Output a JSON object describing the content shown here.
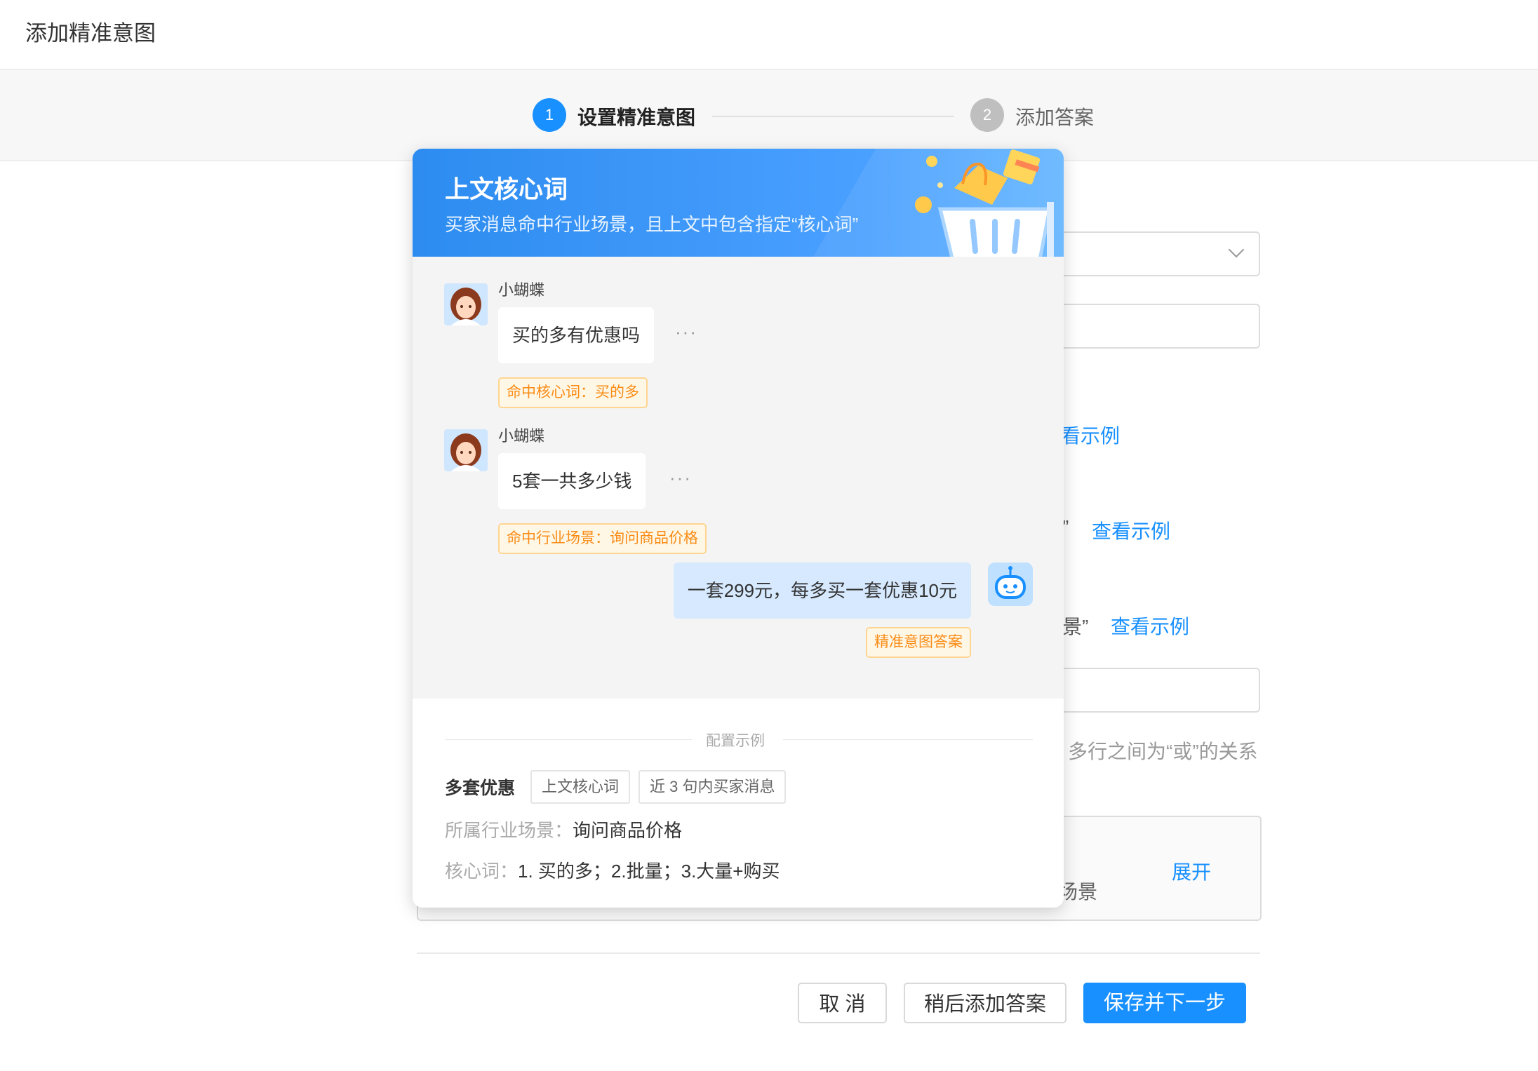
{
  "page": {
    "title": "添加精准意图"
  },
  "steps": [
    {
      "number": "1",
      "label": "设置精准意图",
      "state": "active"
    },
    {
      "number": "2",
      "label": "添加答案",
      "state": "pending"
    }
  ],
  "background": {
    "link_1": "看示例",
    "link_2": "查看示例",
    "link_3": "查看示例",
    "quote_1": "”",
    "quote_2": "景”",
    "hint": "多行之间为“或”的关系",
    "expand_label": "展开",
    "partial_scene": "场景"
  },
  "popup": {
    "title": "上文核心词",
    "subtitle": "买家消息命中行业场景，且上文中包含指定“核心词”",
    "messages": [
      {
        "nick": "小蝴蝶",
        "text": "买的多有优惠吗",
        "more": "···",
        "tag": "命中核心词：买的多"
      },
      {
        "nick": "小蝴蝶",
        "text": "5套一共多少钱",
        "more": "···",
        "tag": "命中行业场景：询问商品价格"
      }
    ],
    "reply": {
      "text": "一套299元，每多买一套优惠10元",
      "tag": "精准意图答案"
    },
    "config": {
      "section_label": "配置示例",
      "name": "多套优惠",
      "tags": [
        "上文核心词",
        "近 3 句内买家消息"
      ],
      "scene_key": "所属行业场景：",
      "scene_value": "询问商品价格",
      "keywords_key": "核心词：",
      "keywords_value": "1. 买的多；2.批量；3.大量+购买"
    }
  },
  "actions": {
    "cancel": "取 消",
    "later": "稍后添加答案",
    "save": "保存并下一步"
  },
  "colors": {
    "primary": "#1890ff",
    "tag_orange": "#fa8c16",
    "reply_bubble": "#d6e9ff",
    "step_pending": "#bfbfbf"
  }
}
